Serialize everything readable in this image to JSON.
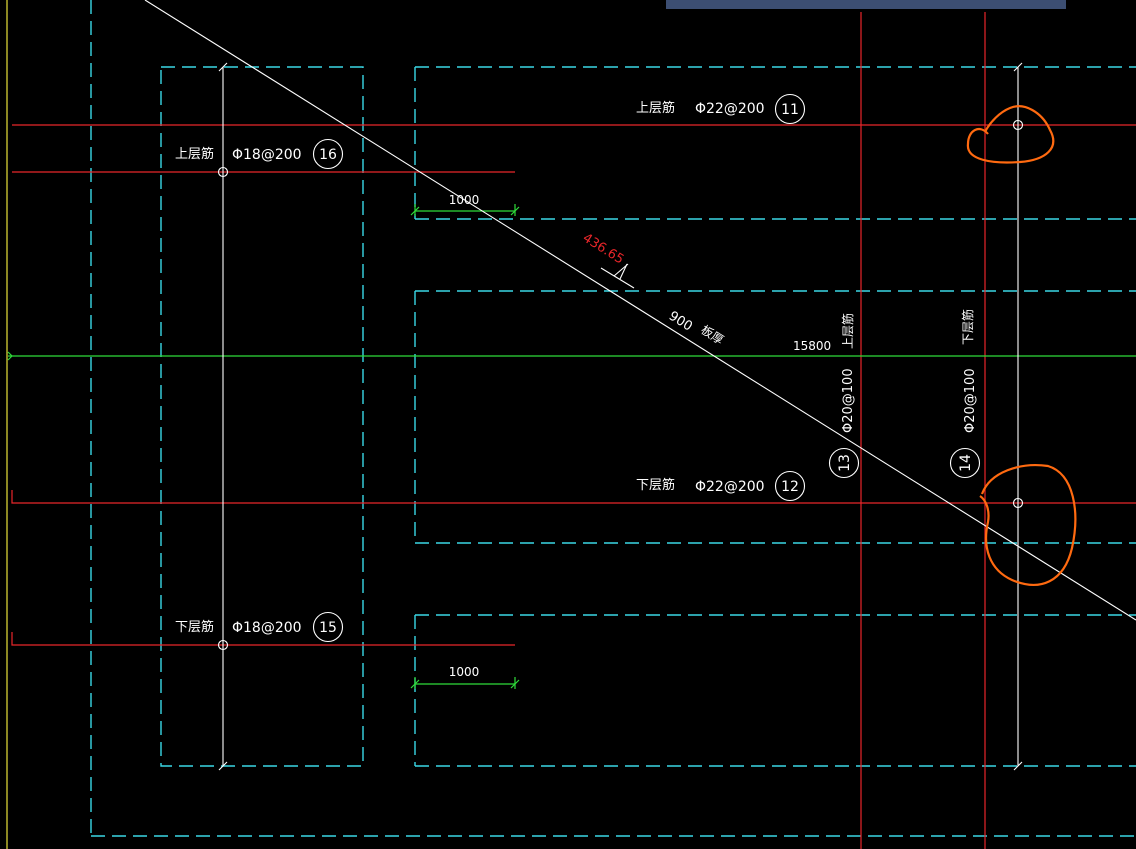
{
  "labels": {
    "top_layer": "上层筋",
    "bottom_layer": "下层筋",
    "phi22_200": "Φ22@200",
    "phi18_200": "Φ18@200",
    "phi20_100": "Φ20@100",
    "dim_1000": "1000",
    "elev_15800": "15800",
    "thickness_900": "900",
    "thickness_suffix": "板厚",
    "red_dim": "436.65"
  },
  "markers": {
    "n11": "11",
    "n12": "12",
    "n13": "13",
    "n14": "14",
    "n15": "15",
    "n16": "16"
  },
  "colors": {
    "background": "#000000",
    "cyan_dashed": "#3ad8e6",
    "red_line": "#e8262a",
    "green_line": "#2fdc3a",
    "white_line": "#ffffff",
    "orange_markup": "#ff6a10",
    "top_bar": "#3c4e72"
  }
}
